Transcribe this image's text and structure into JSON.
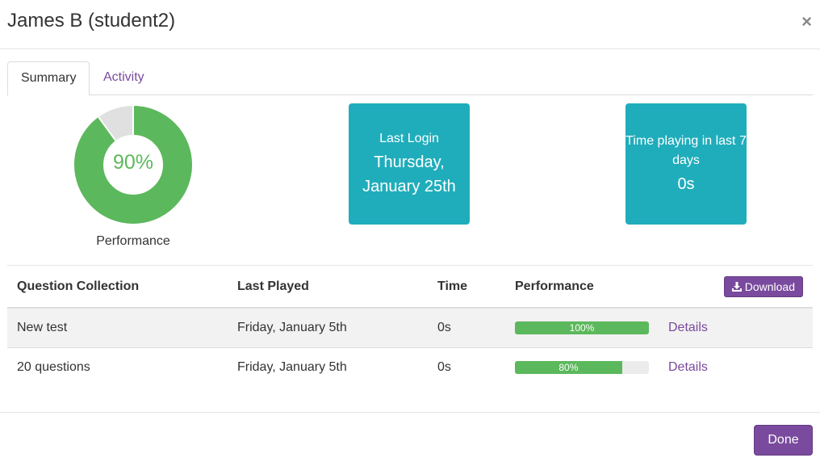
{
  "modal": {
    "title": "James B (student2)",
    "close_symbol": "×"
  },
  "tabs": [
    {
      "label": "Summary",
      "active": true
    },
    {
      "label": "Activity",
      "active": false
    }
  ],
  "summary": {
    "performance_percent": 90,
    "performance_label": "90%",
    "performance_caption": "Performance",
    "last_login": {
      "label": "Last Login",
      "value": "Thursday, January 25th"
    },
    "time_playing": {
      "label": "Time playing in last 7 days",
      "value": "0s"
    }
  },
  "table": {
    "headers": [
      "Question Collection",
      "Last Played",
      "Time",
      "Performance"
    ],
    "download_label": "Download",
    "rows": [
      {
        "collection": "New test",
        "last_played": "Friday, January 5th",
        "time": "0s",
        "performance": 100,
        "performance_label": "100%",
        "details_label": "Details"
      },
      {
        "collection": "20 questions",
        "last_played": "Friday, January 5th",
        "time": "0s",
        "performance": 80,
        "performance_label": "80%",
        "details_label": "Details"
      }
    ]
  },
  "footer": {
    "done_label": "Done"
  },
  "colors": {
    "accent": "#7a4a9e",
    "success": "#5cb85c",
    "info": "#20adbb",
    "track": "#e0e0e0"
  }
}
